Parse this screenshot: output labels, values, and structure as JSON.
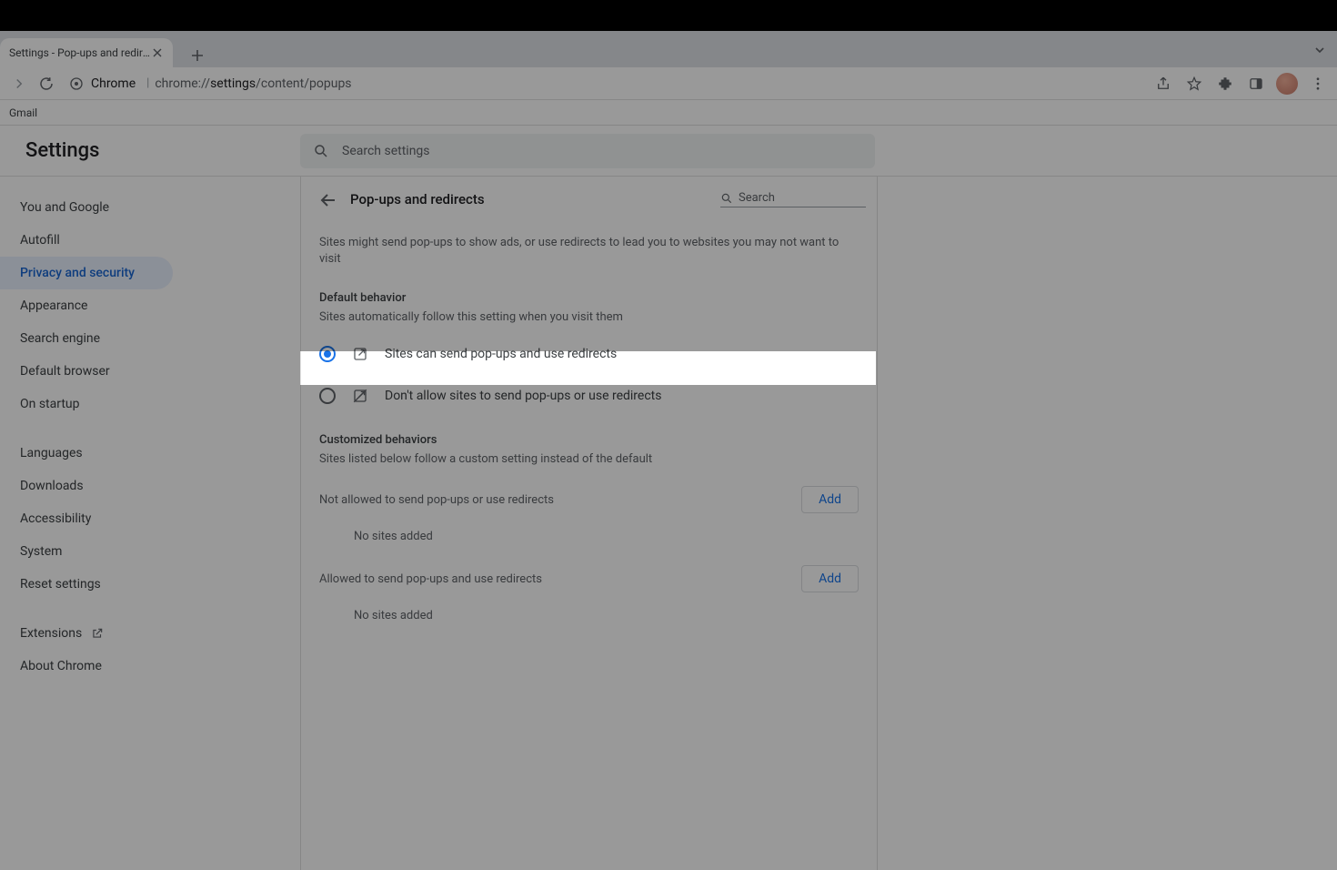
{
  "browser": {
    "tab_title": "Settings - Pop-ups and redirec",
    "url_label_chrome": "Chrome",
    "url_path_prefix": "chrome://",
    "url_path_bold": "settings",
    "url_path_suffix": "/content/popups",
    "bookmarks": [
      "Gmail"
    ]
  },
  "app": {
    "title": "Settings",
    "search_placeholder": "Search settings"
  },
  "sidebar": {
    "groups": [
      [
        "You and Google",
        "Autofill",
        "Privacy and security",
        "Appearance",
        "Search engine",
        "Default browser",
        "On startup"
      ],
      [
        "Languages",
        "Downloads",
        "Accessibility",
        "System",
        "Reset settings"
      ],
      [
        "Extensions",
        "About Chrome"
      ]
    ],
    "active": "Privacy and security"
  },
  "content": {
    "page_title": "Pop-ups and redirects",
    "search_placeholder": "Search",
    "intro": "Sites might send pop-ups to show ads, or use redirects to lead you to websites you may not want to visit",
    "default_behavior_title": "Default behavior",
    "default_behavior_sub": "Sites automatically follow this setting when you visit them",
    "option_allow": "Sites can send pop-ups and use redirects",
    "option_block": "Don't allow sites to send pop-ups or use redirects",
    "customized_title": "Customized behaviors",
    "customized_sub": "Sites listed below follow a custom setting instead of the default",
    "not_allowed_label": "Not allowed to send pop-ups or use redirects",
    "allowed_label": "Allowed to send pop-ups and use redirects",
    "add_label": "Add",
    "no_sites": "No sites added"
  }
}
